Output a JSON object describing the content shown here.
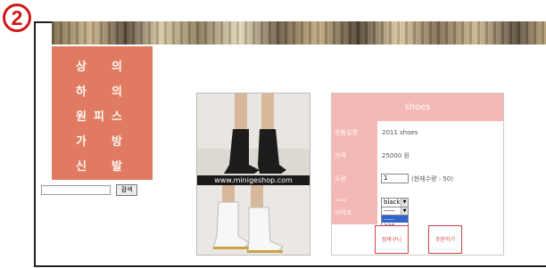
{
  "step_badge": "2",
  "menu": {
    "items": [
      {
        "chars": [
          "상",
          "의"
        ]
      },
      {
        "chars": [
          "하",
          "의"
        ]
      },
      {
        "chars": [
          "원",
          "피",
          "스"
        ]
      },
      {
        "chars": [
          "가",
          "방"
        ]
      },
      {
        "chars": [
          "신",
          "발"
        ]
      }
    ]
  },
  "search": {
    "value": "",
    "button": "검색"
  },
  "product_image": {
    "watermark": "www.minigeshop.com"
  },
  "product": {
    "title": "shoes",
    "rows": [
      {
        "label": "상품설명",
        "value": "2011 shoes"
      },
      {
        "label": "가격",
        "value": "25000 원"
      },
      {
        "label": "수량",
        "input_value": "1",
        "note": "(현재수량 : 50)"
      },
      {
        "label": "색상",
        "select_value": "black"
      },
      {
        "label": "사이즈",
        "select_value": "-----"
      }
    ],
    "size_options": [
      "-----",
      "230",
      "240"
    ],
    "cart_button": "장바구니",
    "order_button": "주문하기"
  },
  "colors": {
    "menu_bg": "#e07a60",
    "form_accent": "#f4b8b6",
    "badge": "#d01818"
  }
}
